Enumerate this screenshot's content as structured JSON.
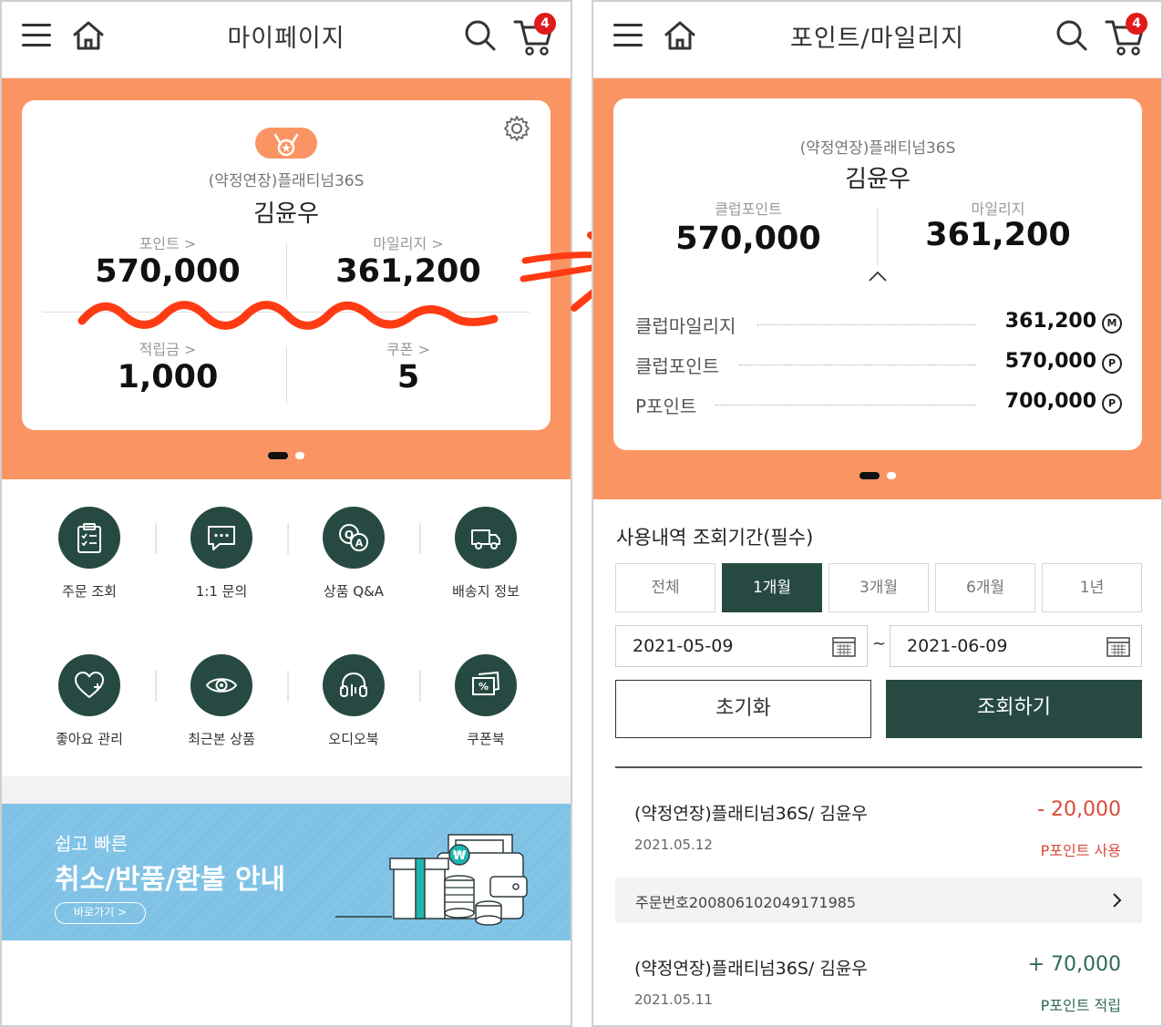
{
  "colors": {
    "orange": "#fb9463",
    "dark_green": "#264a42",
    "red": "#d94a3a",
    "green": "#2e6b55"
  },
  "left": {
    "header": {
      "title": "마이페이지",
      "cart_count": "4"
    },
    "card": {
      "grade": "(약정연장)플래티넘36S",
      "name": "김윤우",
      "stats": [
        {
          "label": "포인트 >",
          "value": "570,000"
        },
        {
          "label": "마일리지 >",
          "value": "361,200"
        },
        {
          "label": "적립금 >",
          "value": "1,000"
        },
        {
          "label": "쿠폰 >",
          "value": "5"
        }
      ]
    },
    "menu": [
      {
        "label": "주문 조회",
        "icon": "clipboard-icon"
      },
      {
        "label": "1:1 문의",
        "icon": "chat-bubble-icon"
      },
      {
        "label": "상품 Q&A",
        "icon": "qa-icon"
      },
      {
        "label": "배송지 정보",
        "icon": "truck-icon"
      },
      {
        "label": "좋아요 관리",
        "icon": "heart-icon"
      },
      {
        "label": "최근본 상품",
        "icon": "eye-icon"
      },
      {
        "label": "오디오북",
        "icon": "headphones-icon"
      },
      {
        "label": "쿠폰북",
        "icon": "coupon-icon"
      }
    ],
    "banner": {
      "subtitle": "쉽고 빠른",
      "title": "취소/반품/환불 안내",
      "button": "바로가기  >"
    }
  },
  "right": {
    "header": {
      "title": "포인트/마일리지",
      "cart_count": "4"
    },
    "card": {
      "grade": "(약정연장)플래티넘36S",
      "name": "김윤우",
      "stats": [
        {
          "label": "클럽포인트",
          "value": "570,000"
        },
        {
          "label": "마일리지",
          "value": "361,200"
        }
      ],
      "rows": [
        {
          "label": "클럽마일리지",
          "value": "361,200",
          "unit": "M"
        },
        {
          "label": "클럽포인트",
          "value": "570,000",
          "unit": "P"
        },
        {
          "label": "P포인트",
          "value": "700,000",
          "unit": "P"
        }
      ]
    },
    "history": {
      "section_title": "사용내역 조회기간(필수)",
      "tabs": [
        "전체",
        "1개월",
        "3개월",
        "6개월",
        "1년"
      ],
      "start_date": "2021-05-09",
      "tilde": "~",
      "end_date": "2021-06-09",
      "reset_label": "초기화",
      "search_label": "조회하기",
      "items": [
        {
          "title": "(약정연장)플래티넘36S/ 김윤우",
          "date": "2021.05.12",
          "amount": "- 20,000",
          "type": "P포인트 사용",
          "order": "주문번호200806102049171985"
        },
        {
          "title": "(약정연장)플래티넘36S/ 김윤우",
          "date": "2021.05.11",
          "amount": "+ 70,000",
          "type": "P포인트 적립"
        }
      ]
    }
  }
}
